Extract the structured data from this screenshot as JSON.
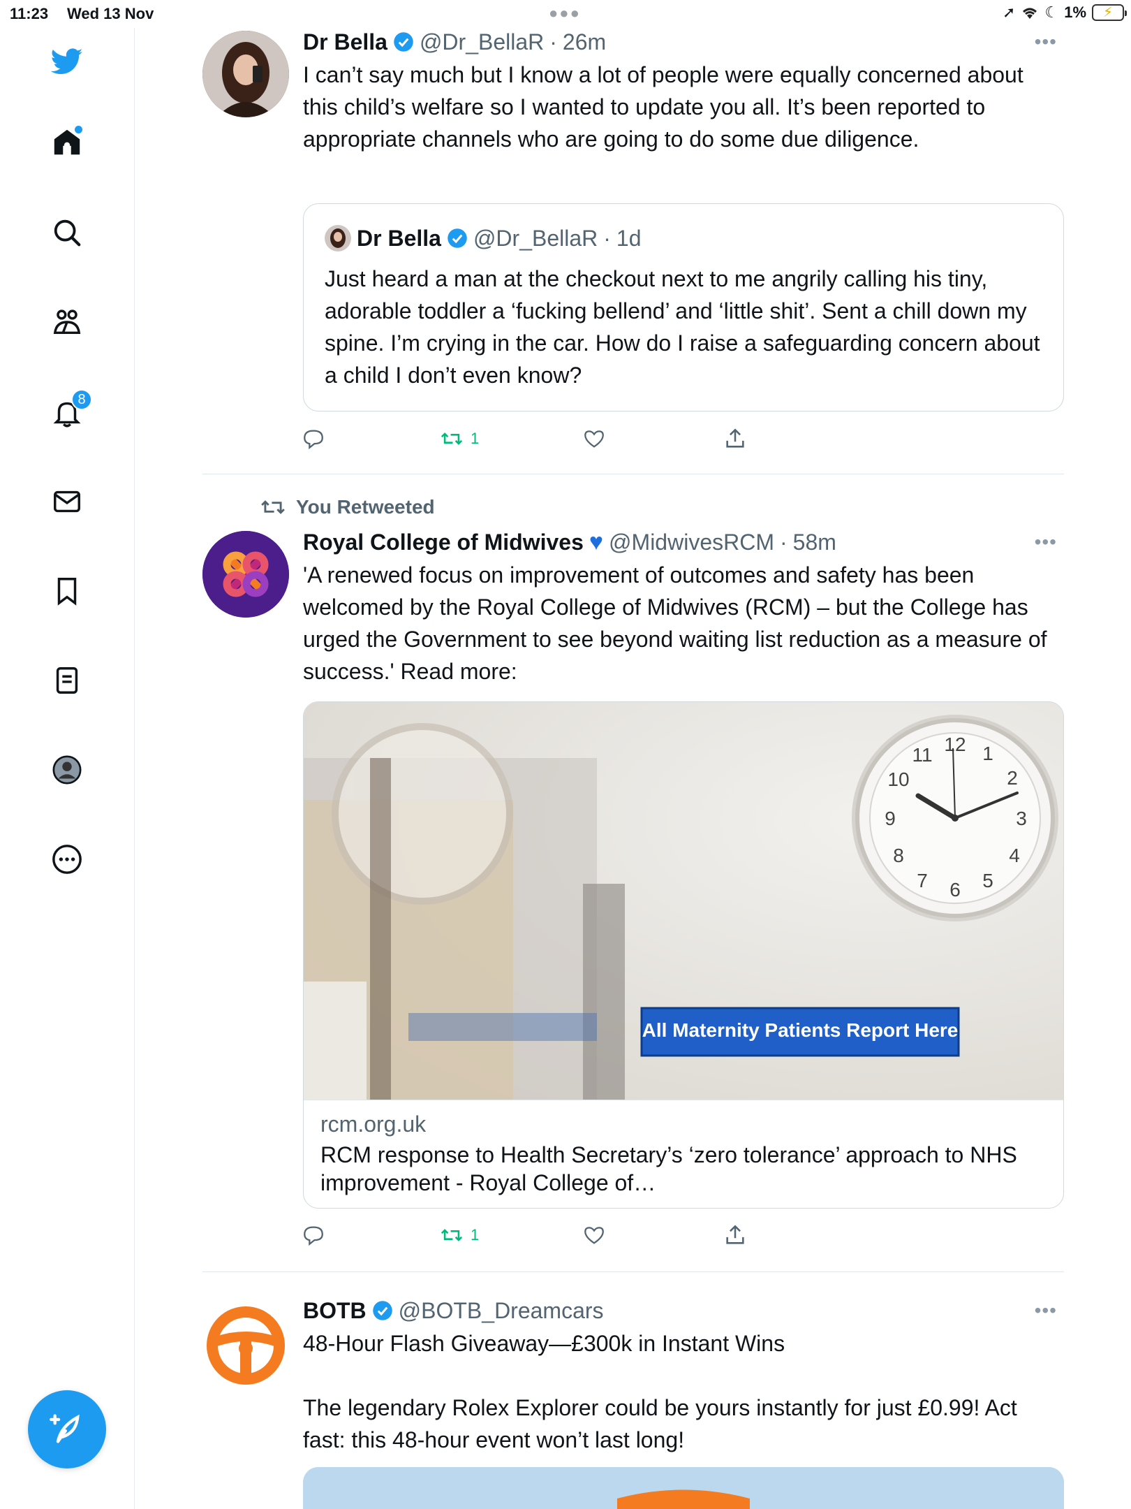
{
  "status": {
    "time": "11:23",
    "date": "Wed 13 Nov",
    "battery": "1%"
  },
  "sidebar": {
    "notification_count": "8",
    "items": [
      "twitter-logo",
      "home-icon",
      "search-icon",
      "communities-icon",
      "notifications-icon",
      "messages-icon",
      "bookmarks-icon",
      "lists-icon",
      "profile-icon",
      "more-icon"
    ]
  },
  "tweets": [
    {
      "name": "Dr Bella",
      "handle": "@Dr_BellaR",
      "time": "26m",
      "text": "I can’t say much but I know a lot of people were equally concerned about this child’s welfare so I wanted to update you all. It’s been reported to appropriate channels who are going to do some due diligence.",
      "quote": {
        "name": "Dr Bella",
        "handle": "@Dr_BellaR",
        "time": "1d",
        "text": "Just heard a man at the checkout next to me angrily calling his tiny, adorable toddler a ‘fucking bellend’ and ‘little shit’. Sent a chill down my spine. I’m crying in the car. How do I raise a safeguarding concern about a child I don’t even know?"
      },
      "retweets": "1"
    },
    {
      "retweet_label": "You Retweeted",
      "name": "Royal College of Midwives",
      "handle": "@MidwivesRCM",
      "time": "58m",
      "text": "'A renewed focus on improvement of outcomes and safety has been welcomed by the Royal College of Midwives (RCM) – but the College has urged the Government to see beyond waiting list reduction as a measure of success.' Read more:",
      "card": {
        "sign_text": "All Maternity Patients Report Here",
        "domain": "rcm.org.uk",
        "title": "RCM response to Health Secretary’s ‘zero tolerance’ approach to NHS improvement - Royal College of…"
      },
      "retweets": "1"
    },
    {
      "name": "BOTB",
      "handle": "@BOTB_Dreamcars",
      "text": "48-Hour Flash Giveaway—£300k in Instant Wins\n\nThe legendary Rolex Explorer could be yours instantly for just £0.99! Act fast: this 48-hour event won’t last long!"
    }
  ],
  "colors": {
    "accent": "#1d9bf0",
    "retweet_green": "#00ba7c",
    "rcm_purple": "#4b1e8c",
    "botb_orange": "#f47b20"
  }
}
